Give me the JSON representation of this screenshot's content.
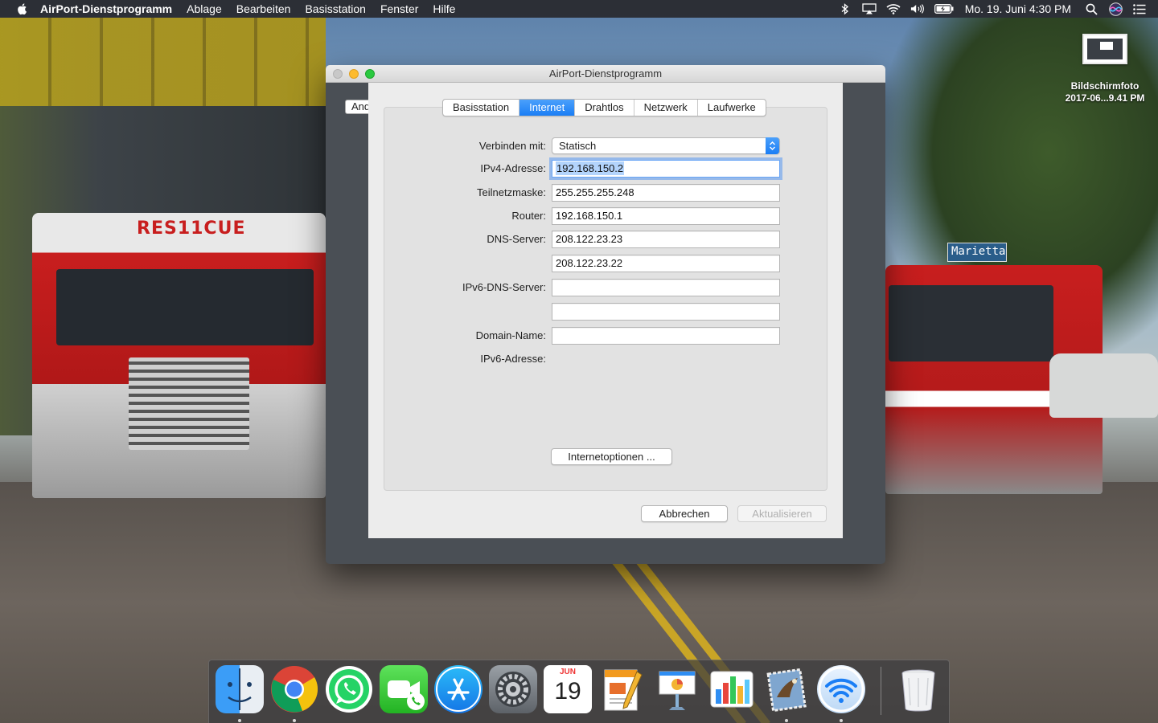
{
  "menubar": {
    "app_name": "AirPort-Dienstprogramm",
    "items": [
      "Ablage",
      "Bearbeiten",
      "Basisstation",
      "Fenster",
      "Hilfe"
    ],
    "clock": "Mo. 19. Juni  4:30 PM",
    "status_icons": [
      "bluetooth-icon",
      "airplay-icon",
      "wifi-icon",
      "volume-icon",
      "battery-icon",
      "spotlight-icon",
      "siri-icon",
      "notification-center-icon"
    ]
  },
  "desktop": {
    "screenshot_label_line1": "Bildschirmfoto",
    "screenshot_label_line2": "2017-06...9.41 PM",
    "wallpaper_truck_text": "RES11CUE",
    "wallpaper_street_sign": "Marietta"
  },
  "window": {
    "title": "AirPort-Dienstprogramm",
    "behind_tab_label": "And"
  },
  "sheet": {
    "tabs": [
      {
        "label": "Basisstation",
        "active": false
      },
      {
        "label": "Internet",
        "active": true
      },
      {
        "label": "Drahtlos",
        "active": false
      },
      {
        "label": "Netzwerk",
        "active": false
      },
      {
        "label": "Laufwerke",
        "active": false
      }
    ],
    "connect_via": {
      "label": "Verbinden mit:",
      "value": "Statisch"
    },
    "ipv4": {
      "label": "IPv4-Adresse:",
      "value": "192.168.150.2"
    },
    "subnet": {
      "label": "Teilnetzmaske:",
      "value": "255.255.255.248"
    },
    "router": {
      "label": "Router:",
      "value": "192.168.150.1"
    },
    "dns": {
      "label": "DNS-Server:",
      "value1": "208.122.23.23",
      "value2": "208.122.23.22"
    },
    "ipv6_dns": {
      "label": "IPv6-DNS-Server:",
      "value1": "",
      "value2": ""
    },
    "domain": {
      "label": "Domain-Name:",
      "value": ""
    },
    "ipv6_address": {
      "label": "IPv6-Adresse:",
      "value": ""
    },
    "internet_options_button": "Internetoptionen ...",
    "cancel_button": "Abbrechen",
    "update_button": "Aktualisieren"
  },
  "dock": {
    "apps": [
      "Finder",
      "Google Chrome",
      "WhatsApp",
      "FaceTime",
      "App Store",
      "Systemeinstellungen",
      "Kalender",
      "Pages",
      "Keynote",
      "Numbers",
      "Mail",
      "AirPort-Dienstprogramm",
      "Papierkorb"
    ],
    "calendar_month": "JUN",
    "calendar_day": "19"
  },
  "colors": {
    "accent": "#1a7ef5",
    "menubar_bg": "#28282c",
    "sheet_bg": "#ececec"
  }
}
